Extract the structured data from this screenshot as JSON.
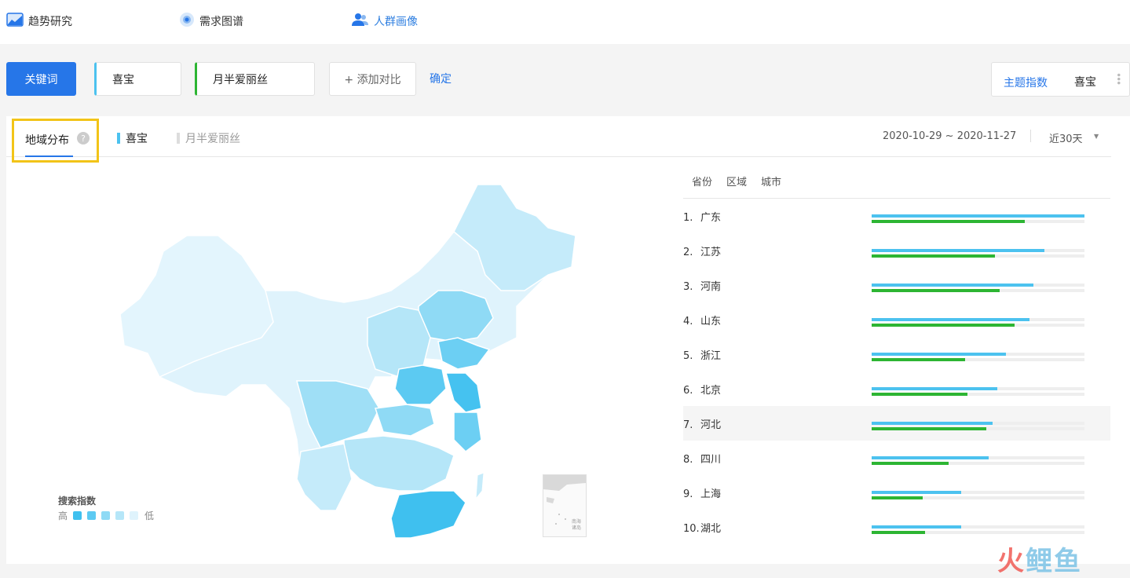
{
  "topnav": {
    "tabs": [
      {
        "label": "趋势研究",
        "icon": "chart-area-icon"
      },
      {
        "label": "需求图谱",
        "icon": "radar-dot-icon"
      },
      {
        "label": "人群画像",
        "icon": "users-icon"
      }
    ]
  },
  "search": {
    "keyword_button": "关键词",
    "keywords": [
      "喜宝",
      "月半爱丽丝"
    ],
    "add_compare": "+ 添加对比",
    "confirm": "确定"
  },
  "theme": {
    "label": "主题指数",
    "value": "喜宝"
  },
  "panel": {
    "tab": "地域分布",
    "legend": [
      "喜宝",
      "月半爱丽丝"
    ],
    "date_range": "2020-10-29 ~ 2020-11-27",
    "period": "近30天",
    "sub_tabs": [
      "省份",
      "区域",
      "城市"
    ],
    "scale_title": "搜索指数",
    "scale_high": "高",
    "scale_low": "低",
    "nanhai_label": "南海诸岛"
  },
  "ranking": [
    {
      "rank": "1.",
      "name": "广东",
      "a": 1.0,
      "b": 0.72
    },
    {
      "rank": "2.",
      "name": "江苏",
      "a": 0.81,
      "b": 0.58
    },
    {
      "rank": "3.",
      "name": "河南",
      "a": 0.76,
      "b": 0.6
    },
    {
      "rank": "4.",
      "name": "山东",
      "a": 0.74,
      "b": 0.67
    },
    {
      "rank": "5.",
      "name": "浙江",
      "a": 0.63,
      "b": 0.44
    },
    {
      "rank": "6.",
      "name": "北京",
      "a": 0.59,
      "b": 0.45
    },
    {
      "rank": "7.",
      "name": "河北",
      "a": 0.57,
      "b": 0.54
    },
    {
      "rank": "8.",
      "name": "四川",
      "a": 0.55,
      "b": 0.36
    },
    {
      "rank": "9.",
      "name": "上海",
      "a": 0.42,
      "b": 0.24
    },
    {
      "rank": "10.",
      "name": "湖北",
      "a": 0.42,
      "b": 0.25
    }
  ],
  "colors": {
    "series_a": "#4cc2ef",
    "series_b": "#2db533",
    "accent": "#2676e8",
    "highlight": "#f2c418"
  },
  "watermark": {
    "part1": "火",
    "part2": "鲤鱼"
  }
}
